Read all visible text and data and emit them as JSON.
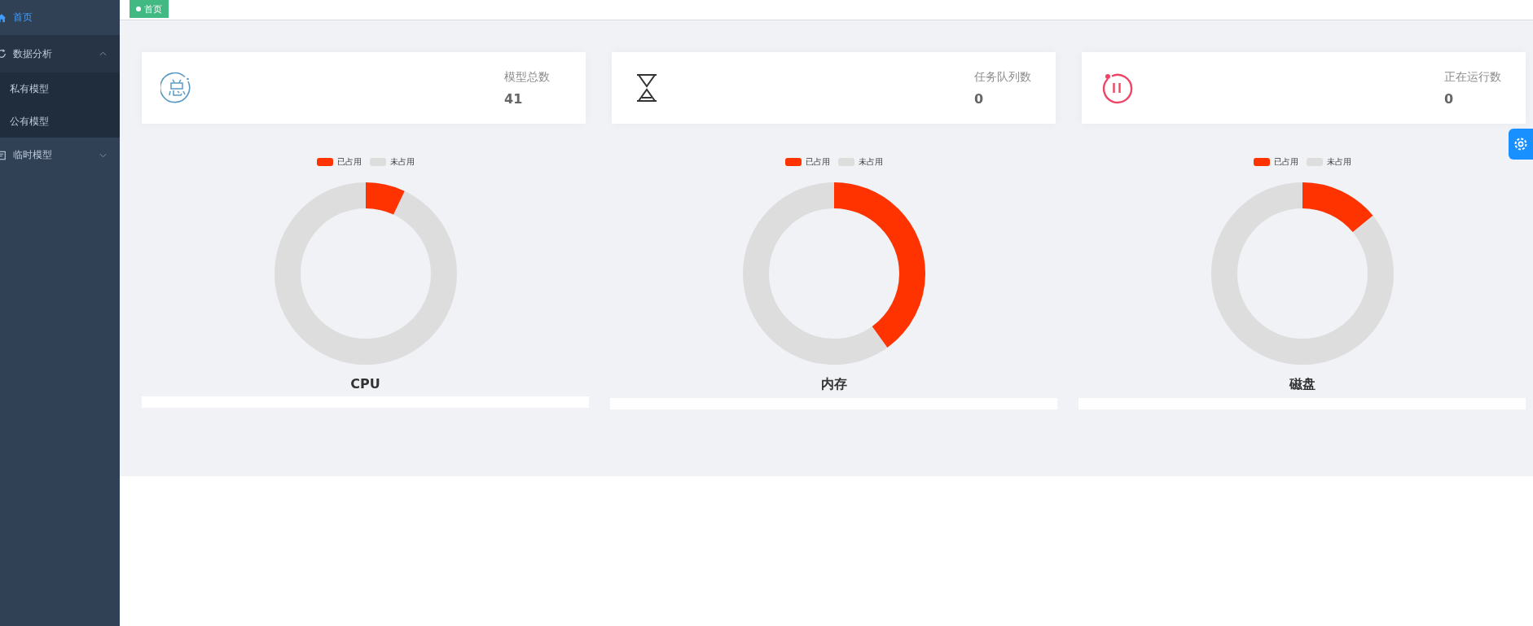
{
  "sidebar": {
    "items": [
      {
        "kind": "home",
        "label": "首页",
        "selected": true
      },
      {
        "kind": "analysis",
        "label": "数据分析",
        "selected": false,
        "expanded": true,
        "children": [
          {
            "label": "私有模型",
            "selected": false
          },
          {
            "label": "公有模型",
            "selected": false
          }
        ]
      },
      {
        "kind": "temp",
        "label": "临时模型",
        "selected": false,
        "expanded": false
      }
    ]
  },
  "tags": [
    {
      "label": "首页",
      "selected": true
    }
  ],
  "stats": [
    {
      "kind": "total",
      "label": "模型总数",
      "value": "41"
    },
    {
      "kind": "queue",
      "label": "任务队列数",
      "value": "0"
    },
    {
      "kind": "running",
      "label": "正在运行数",
      "value": "0"
    }
  ],
  "gauges": [
    {
      "title": "CPU",
      "level": 0.07,
      "legend": [
        {
          "label": "已占用",
          "color": "#ff3300"
        },
        {
          "label": "未占用",
          "color": "#dddddd"
        }
      ]
    },
    {
      "title": "内存",
      "level": 0.4,
      "legend": [
        {
          "label": "已占用",
          "color": "#ff3300"
        },
        {
          "label": "未占用",
          "color": "#dddddd"
        }
      ]
    },
    {
      "title": "磁盘",
      "level": 0.14,
      "legend": [
        {
          "label": "已占用",
          "color": "#ff3300"
        },
        {
          "label": "未占用",
          "color": "#dddddd"
        }
      ]
    }
  ]
}
